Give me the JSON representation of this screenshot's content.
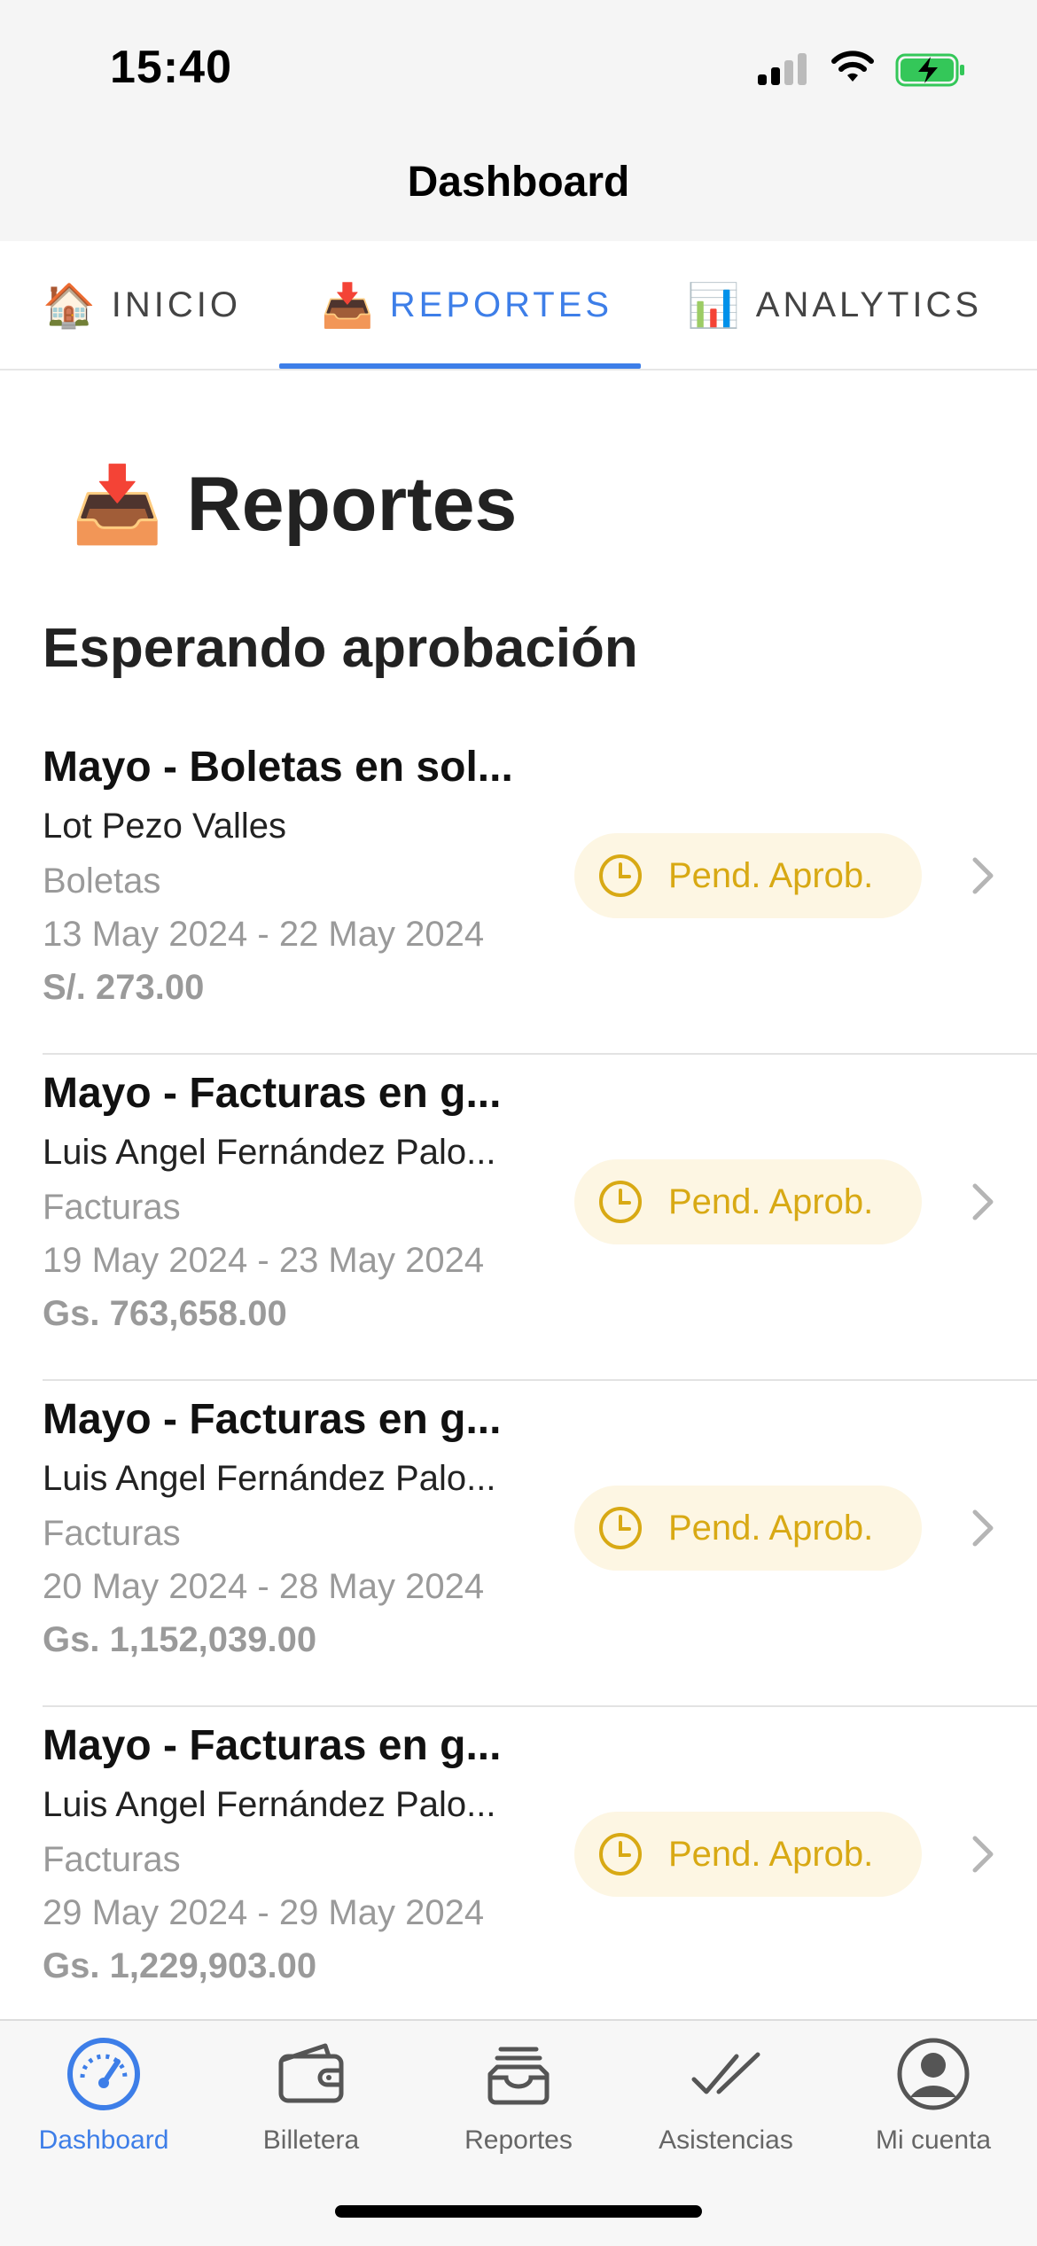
{
  "status_bar": {
    "time": "15:40",
    "icons": [
      "signal-icon",
      "wifi-icon",
      "battery-charging-icon"
    ],
    "battery_color": "#34c759"
  },
  "nav": {
    "title": "Dashboard"
  },
  "tabs": [
    {
      "emoji": "🏠",
      "label": "INICIO",
      "active": false
    },
    {
      "emoji": "📥",
      "label": "REPORTES",
      "active": true
    },
    {
      "emoji": "📊",
      "label": "ANALYTICS",
      "active": false
    }
  ],
  "page": {
    "emoji": "📥",
    "title": "Reportes",
    "section_title": "Esperando aprobación"
  },
  "reports": [
    {
      "title": "Mayo - Boletas en sol...",
      "user": "Lot Pezo Valles",
      "type": "Boletas",
      "dates": "13 May 2024 - 22 May 2024",
      "amount": "S/. 273.00",
      "status": "Pend. Aprob."
    },
    {
      "title": "Mayo - Facturas en g...",
      "user": "Luis Angel Fernández Palo...",
      "type": "Facturas",
      "dates": "19 May 2024 - 23 May 2024",
      "amount": "Gs. 763,658.00",
      "status": "Pend. Aprob."
    },
    {
      "title": "Mayo - Facturas en g...",
      "user": "Luis Angel Fernández Palo...",
      "type": "Facturas",
      "dates": "20 May 2024 - 28 May 2024",
      "amount": "Gs. 1,152,039.00",
      "status": "Pend. Aprob."
    },
    {
      "title": "Mayo - Facturas en g...",
      "user": "Luis Angel Fernández Palo...",
      "type": "Facturas",
      "dates": "29 May 2024 - 29 May 2024",
      "amount": "Gs. 1,229,903.00",
      "status": "Pend. Aprob."
    }
  ],
  "tab_bar": [
    {
      "label": "Dashboard",
      "icon": "speedometer-icon",
      "active": true
    },
    {
      "label": "Billetera",
      "icon": "wallet-icon",
      "active": false
    },
    {
      "label": "Reportes",
      "icon": "tray-icon",
      "active": false
    },
    {
      "label": "Asistencias",
      "icon": "double-check-icon",
      "active": false
    },
    {
      "label": "Mi cuenta",
      "icon": "account-icon",
      "active": false
    }
  ],
  "colors": {
    "accent": "#3d7ee8",
    "pending": "#d8a914",
    "pending_bg": "#fdf6e3"
  }
}
